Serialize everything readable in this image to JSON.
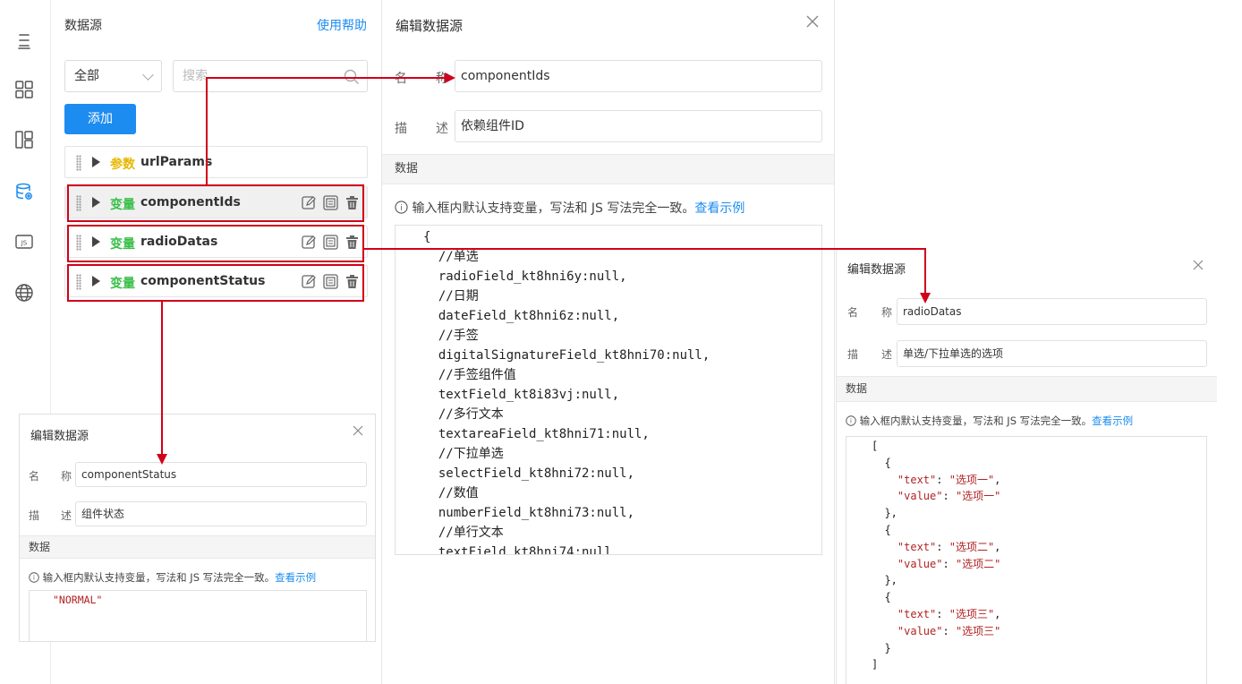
{
  "datasource_panel": {
    "title": "数据源",
    "help_link": "使用帮助",
    "filter": {
      "selected": "全部"
    },
    "search": {
      "placeholder": "搜索"
    },
    "add_button": "添加",
    "items": [
      {
        "kind": "参数",
        "name": "urlParams"
      },
      {
        "kind": "变量",
        "name": "componentIds"
      },
      {
        "kind": "变量",
        "name": "radioDatas"
      },
      {
        "kind": "变量",
        "name": "componentStatus"
      }
    ]
  },
  "editor_main": {
    "title": "编辑数据源",
    "name_label_1": "名",
    "name_label_2": "称",
    "name_value": "componentIds",
    "desc_label_1": "描",
    "desc_label_2": "述",
    "desc_value": "依赖组件ID",
    "section": "数据",
    "tip": "输入框内默认支持变量，写法和 JS 写法完全一致。",
    "tip_link": "查看示例",
    "code": "{\n  //单选\n  radioField_kt8hni6y:null,\n  //日期\n  dateField_kt8hni6z:null,\n  //手签\n  digitalSignatureField_kt8hni70:null,\n  //手签组件值\n  textField_kt8i83vj:null,\n  //多行文本\n  textareaField_kt8hni71:null,\n  //下拉单选\n  selectField_kt8hni72:null,\n  //数值\n  numberField_kt8hni73:null,\n  //单行文本\n  textField_kt8hni74:null"
  },
  "editor_status": {
    "title": "编辑数据源",
    "name_label_1": "名",
    "name_label_2": "称",
    "name_value": "componentStatus",
    "desc_label_1": "描",
    "desc_label_2": "述",
    "desc_value": "组件状态",
    "section": "数据",
    "tip": "输入框内默认支持变量，写法和 JS 写法完全一致。",
    "tip_link": "查看示例",
    "code": "\"NORMAL\""
  },
  "editor_radio": {
    "title": "编辑数据源",
    "name_label_1": "名",
    "name_label_2": "称",
    "name_value": "radioDatas",
    "desc_label_1": "描",
    "desc_label_2": "述",
    "desc_value": "单选/下拉单选的选项",
    "section": "数据",
    "tip": "输入框内默认支持变量，写法和 JS 写法完全一致。",
    "tip_link": "查看示例",
    "options": [
      {
        "text": "选项一",
        "value": "选项一"
      },
      {
        "text": "选项二",
        "value": "选项二"
      },
      {
        "text": "选项三",
        "value": "选项三"
      }
    ]
  },
  "colors": {
    "accent": "#1c8cf0",
    "param": "#e6b800",
    "var": "#3bbf4a",
    "annotation": "#d0021b"
  },
  "rail_icons": [
    "outline-icon",
    "components-icon",
    "layout-icon",
    "datasource-icon",
    "js-icon",
    "globe-icon"
  ]
}
